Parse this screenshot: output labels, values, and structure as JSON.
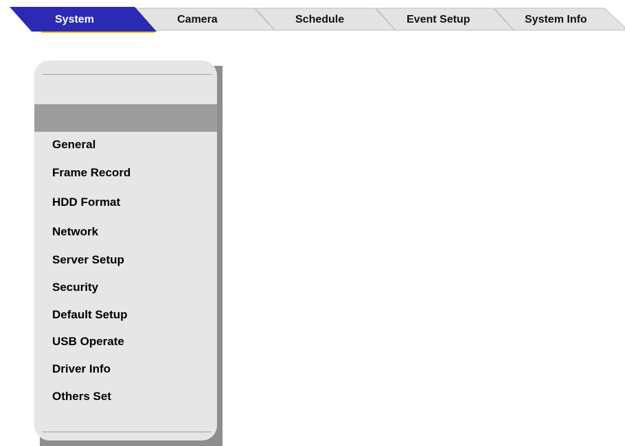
{
  "tabs": [
    {
      "label": "System",
      "active": true
    },
    {
      "label": "Camera",
      "active": false
    },
    {
      "label": "Schedule",
      "active": false
    },
    {
      "label": "Event Setup",
      "active": false
    },
    {
      "label": "System Info",
      "active": false
    }
  ],
  "sidebar": {
    "highlighted_item": "",
    "items": [
      {
        "label": "General"
      },
      {
        "label": "Frame Record"
      },
      {
        "label": "HDD Format"
      },
      {
        "label": "Network"
      },
      {
        "label": "Server Setup"
      },
      {
        "label": "Security"
      },
      {
        "label": "Default Setup"
      },
      {
        "label": "USB Operate"
      },
      {
        "label": "Driver Info"
      },
      {
        "label": "Others Set"
      }
    ]
  },
  "colors": {
    "active_tab": "#2a2ab4",
    "inactive_tab": "#e3e3e3",
    "tab_underline": "#f5c400",
    "panel_bg": "#e6e6e6",
    "panel_highlight": "#9c9c9c",
    "panel_shadow": "#8e8e8e"
  }
}
